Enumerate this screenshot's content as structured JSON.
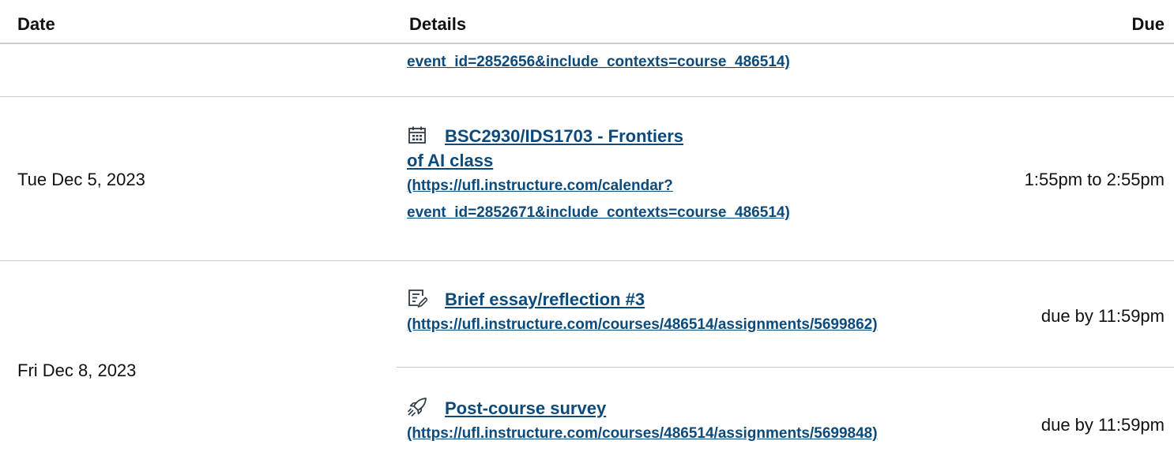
{
  "header": {
    "date_label": "Date",
    "details_label": "Details",
    "due_label": "Due"
  },
  "rows": [
    {
      "items": [
        {
          "url_line2": "event_id=2852656&include_contexts=course_486514)"
        }
      ]
    },
    {
      "date": "Tue Dec 5, 2023",
      "items": [
        {
          "icon": "calendar-icon",
          "title_line1": "BSC2930/IDS1703 - Frontiers",
          "title_line2": "of AI class",
          "url_line1": "(https://ufl.instructure.com/calendar?",
          "url_line2": "event_id=2852671&include_contexts=course_486514)",
          "due": "1:55pm to 2:55pm"
        }
      ]
    },
    {
      "date": "Fri Dec 8, 2023",
      "items": [
        {
          "icon": "assignment-icon",
          "title": "Brief essay/reflection #3",
          "url": "(https://ufl.instructure.com/courses/486514/assignments/5699862)",
          "due": "due by 11:59pm"
        },
        {
          "icon": "quiz-rocket-icon",
          "title": "Post-course survey",
          "url": "(https://ufl.instructure.com/courses/486514/assignments/5699848)",
          "due": "due by 11:59pm"
        }
      ]
    }
  ],
  "colors": {
    "link": "#0b4a7a",
    "divider": "#c7cdd1",
    "text": "#111111"
  }
}
